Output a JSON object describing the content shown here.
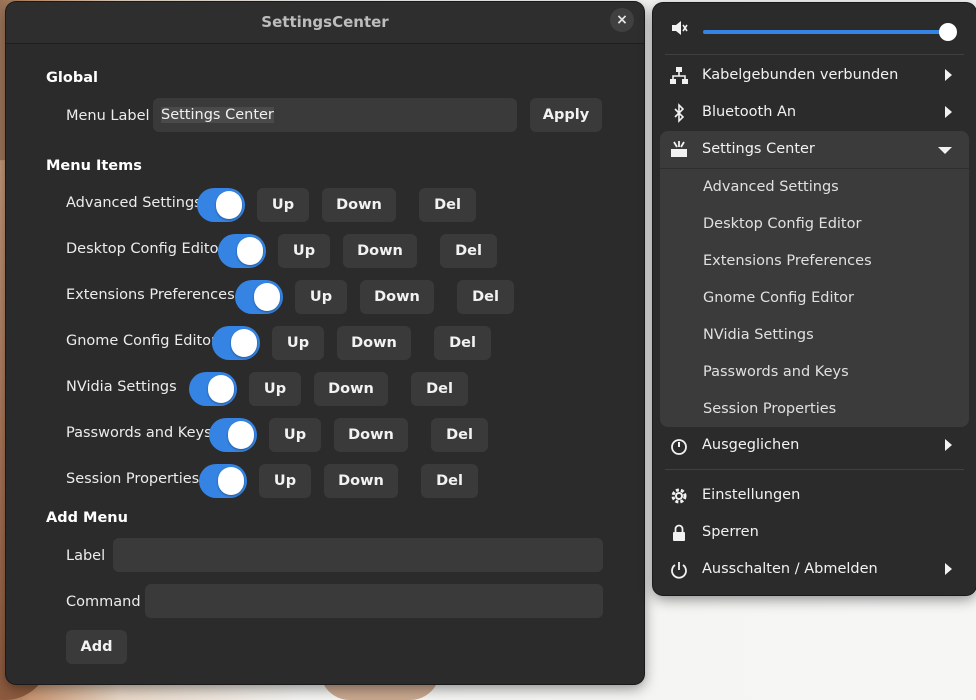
{
  "window": {
    "title": "SettingsCenter",
    "close_glyph": "×",
    "global": {
      "heading": "Global",
      "menu_label_label": "Menu Label",
      "menu_label_value": "Settings Center",
      "apply_label": "Apply"
    },
    "menu_items": {
      "heading": "Menu Items",
      "up_label": "Up",
      "down_label": "Down",
      "del_label": "Del",
      "items": [
        {
          "name": "Advanced Settings",
          "enabled": true
        },
        {
          "name": "Desktop Config Editor",
          "enabled": true
        },
        {
          "name": "Extensions Preferences",
          "enabled": true
        },
        {
          "name": "Gnome Config Editor",
          "enabled": true
        },
        {
          "name": "NVidia Settings",
          "enabled": true
        },
        {
          "name": "Passwords and Keys",
          "enabled": true
        },
        {
          "name": "Session Properties",
          "enabled": true
        }
      ]
    },
    "add_menu": {
      "heading": "Add Menu",
      "label_label": "Label",
      "label_value": "",
      "command_label": "Command",
      "command_value": "",
      "add_label": "Add"
    }
  },
  "quick_menu": {
    "volume": {
      "icon": "speaker-muted-icon",
      "level": 1.0
    },
    "wired": {
      "icon": "network-wired-icon",
      "label": "Kabelgebunden verbunden"
    },
    "bluetooth": {
      "icon": "bluetooth-icon",
      "label": "Bluetooth An"
    },
    "settings_center": {
      "icon": "settings-center-icon",
      "label": "Settings Center",
      "submenu": [
        "Advanced Settings",
        "Desktop Config Editor",
        "Extensions Preferences",
        "Gnome Config Editor",
        "NVidia Settings",
        "Passwords and Keys",
        "Session Properties"
      ]
    },
    "power_mode": {
      "icon": "power-profile-icon",
      "label": "Ausgeglichen"
    },
    "settings": {
      "icon": "gear-icon",
      "label": "Einstellungen"
    },
    "lock": {
      "icon": "lock-icon",
      "label": "Sperren"
    },
    "power": {
      "icon": "power-icon",
      "label": "Ausschalten / Abmelden"
    }
  },
  "colors": {
    "accent": "#3584e4",
    "window_bg": "#2b2b2b",
    "button_bg": "#3a3a3a",
    "submenu_bg": "#3b3b3b"
  }
}
